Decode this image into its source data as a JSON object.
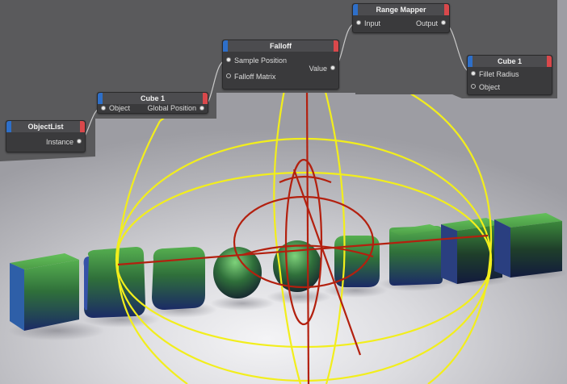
{
  "nodes": {
    "objectlist": {
      "title": "ObjectList",
      "outputs": [
        "Instance"
      ]
    },
    "cube_a": {
      "title": "Cube 1",
      "inputs": [
        "Object"
      ],
      "outputs": [
        "Global Position"
      ]
    },
    "falloff": {
      "title": "Falloff",
      "inputs": [
        "Sample Position",
        "Falloff Matrix"
      ],
      "outputs": [
        "Value"
      ]
    },
    "range_mapper": {
      "title": "Range Mapper",
      "inputs": [
        "Input"
      ],
      "outputs": [
        "Output"
      ]
    },
    "cube_b": {
      "title": "Cube 1",
      "inputs": [
        "Fillet Radius",
        "Object"
      ]
    }
  },
  "colors": {
    "node_header_input_accent": "#2e6fc9",
    "node_header_output_accent": "#d9484b",
    "falloff_gizmo": "#f2ee1c",
    "null_gizmo": "#b3200f",
    "cube_top": "#4fa04a",
    "cube_bottom": "#1e2f6a"
  },
  "scene": {
    "description_icons": [
      "falloff-sphere-gizmo",
      "null-axis-gizmo",
      "cube-object"
    ]
  }
}
